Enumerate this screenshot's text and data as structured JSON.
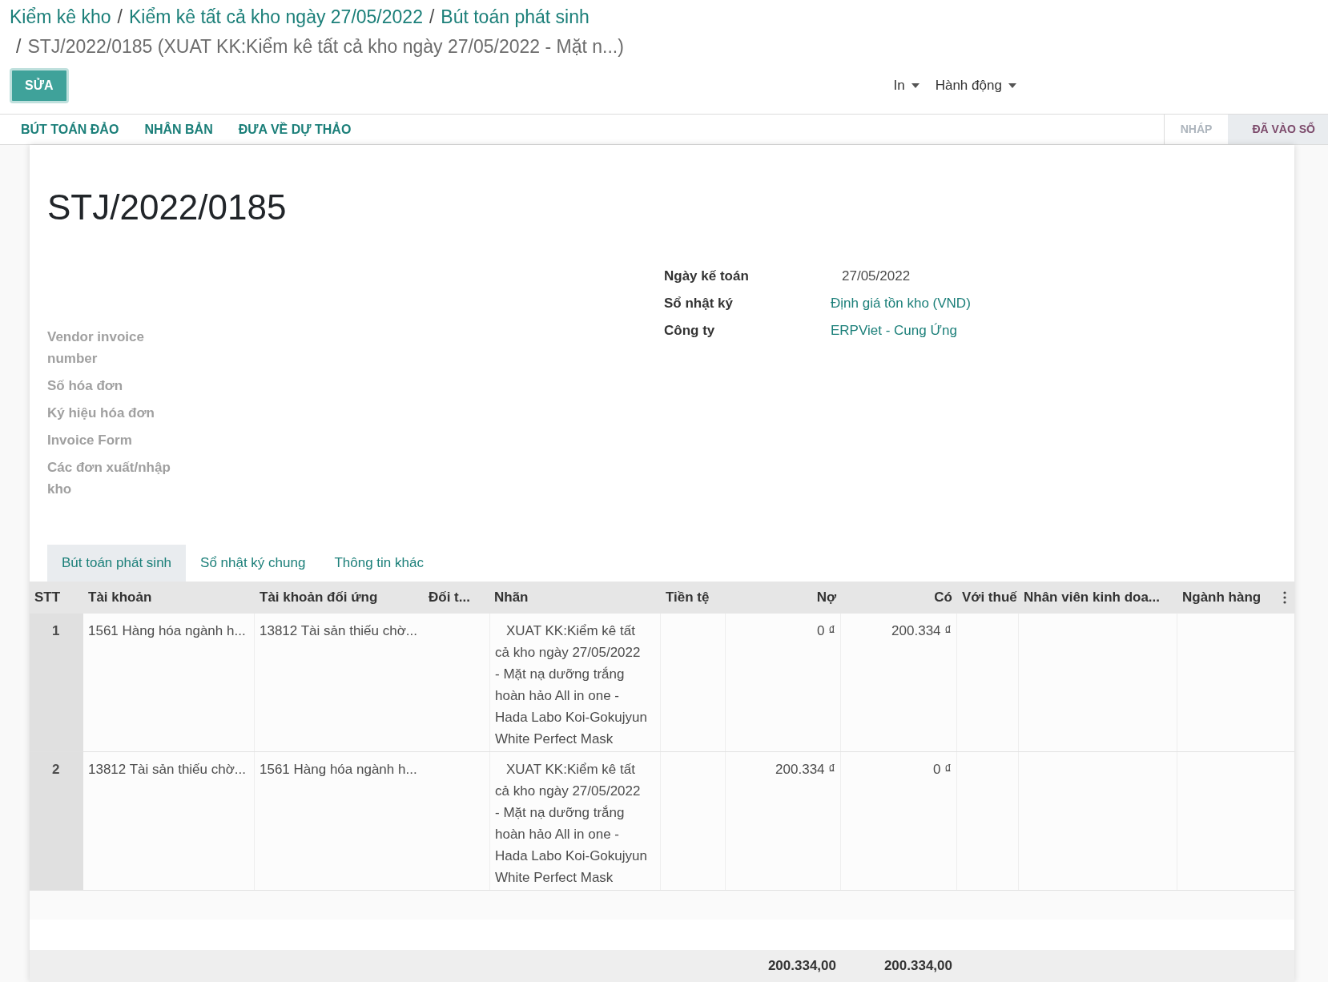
{
  "breadcrumb": {
    "links": [
      "Kiểm kê kho",
      "Kiểm kê tất cả kho ngày 27/05/2022",
      "Bút toán phát sinh"
    ],
    "separator": "/",
    "current": "STJ/2022/0185 (XUAT KK:Kiểm kê tất cả kho ngày 27/05/2022 - Mặt n...)"
  },
  "edit_button": "SỬA",
  "menus": [
    "In",
    "Hành động"
  ],
  "actions": [
    "BÚT TOÁN ĐẢO",
    "NHÂN BẢN",
    "ĐƯA VỀ DỰ THẢO"
  ],
  "status_steps": [
    {
      "label": "NHÁP",
      "selected": false
    },
    {
      "label": "ĐÃ VÀO SỔ",
      "selected": true
    }
  ],
  "title": "STJ/2022/0185",
  "left_fields": [
    "Vendor invoice number",
    "Số hóa đơn",
    "Ký hiệu hóa đơn",
    "Invoice Form",
    "Các đơn xuất/nhập kho"
  ],
  "right_fields": [
    {
      "label": "Ngày kế toán",
      "value": "27/05/2022",
      "link": false
    },
    {
      "label": "Sổ nhật ký",
      "value": "Định giá tồn kho (VND)",
      "link": true
    },
    {
      "label": "Công ty",
      "value": "ERPViet - Cung Ứng",
      "link": true
    }
  ],
  "tabs": [
    {
      "label": "Bút toán phát sinh",
      "selected": true
    },
    {
      "label": "Sổ nhật ký chung",
      "selected": false
    },
    {
      "label": "Thông tin khác",
      "selected": false
    }
  ],
  "table": {
    "columns": [
      "STT",
      "Tài khoản",
      "Tài khoản đối ứng",
      "Đối t...",
      "Nhãn",
      "Tiền tệ",
      "Nợ",
      "Có",
      "Với thuế",
      "Nhân viên kinh doa...",
      "Ngành hàng"
    ],
    "rows": [
      {
        "stt": "1",
        "account": "1561 Hàng hóa ngành h...",
        "counter": "13812 Tài sản thiếu chờ...",
        "label": "XUAT KK:Kiểm kê tất cả kho ngày 27/05/2022 - Mặt nạ dưỡng trắng hoàn hảo All in one - Hada Labo Koi-Gokujyun White Perfect Mask",
        "debit": "0 ₫",
        "credit": "200.334 ₫"
      },
      {
        "stt": "2",
        "account": "13812 Tài sản thiếu chờ...",
        "counter": "1561 Hàng hóa ngành h...",
        "label": "XUAT KK:Kiểm kê tất cả kho ngày 27/05/2022 - Mặt nạ dưỡng trắng hoàn hảo All in one - Hada Labo Koi-Gokujyun White Perfect Mask",
        "debit": "200.334 ₫",
        "credit": "0 ₫"
      }
    ],
    "totals": {
      "debit": "200.334,00",
      "credit": "200.334,00"
    }
  }
}
